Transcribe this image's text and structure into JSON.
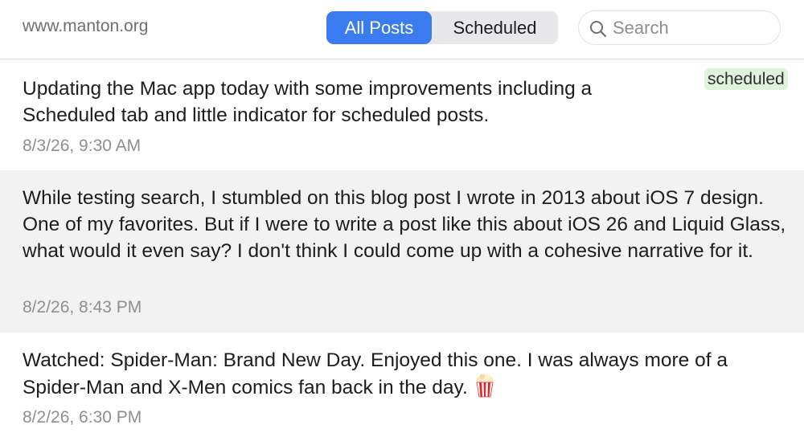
{
  "header": {
    "site": "www.manton.org",
    "tabs": [
      {
        "label": "All Posts",
        "selected": true
      },
      {
        "label": "Scheduled",
        "selected": false
      }
    ],
    "search": {
      "placeholder": "Search",
      "value": ""
    }
  },
  "posts": [
    {
      "text": "Updating the Mac app today with some improvements including a Scheduled tab and little indicator for scheduled posts.",
      "date": "8/3/26, 9:30 AM",
      "badge": "scheduled"
    },
    {
      "text": "While testing search, I stumbled on this blog post I wrote in 2013 about iOS 7 design. One of my favorites. But if I were to write a post like this about iOS 26 and Liquid Glass, what would it even say? I don't think I could come up with a cohesive narrative for it.",
      "date": "8/2/26, 8:43 PM"
    },
    {
      "text": "Watched: Spider-Man: Brand New Day. Enjoyed this one. I was always more of a Spider-Man and X-Men comics fan back in the day.",
      "date": "8/2/26, 6:30 PM",
      "emoji": "popcorn-icon"
    }
  ],
  "colors": {
    "accent": "#3a7bef",
    "badge_bg": "#dff3dc",
    "selected_row_bg": "#f2f2f3",
    "date_text": "#8e8e93"
  }
}
